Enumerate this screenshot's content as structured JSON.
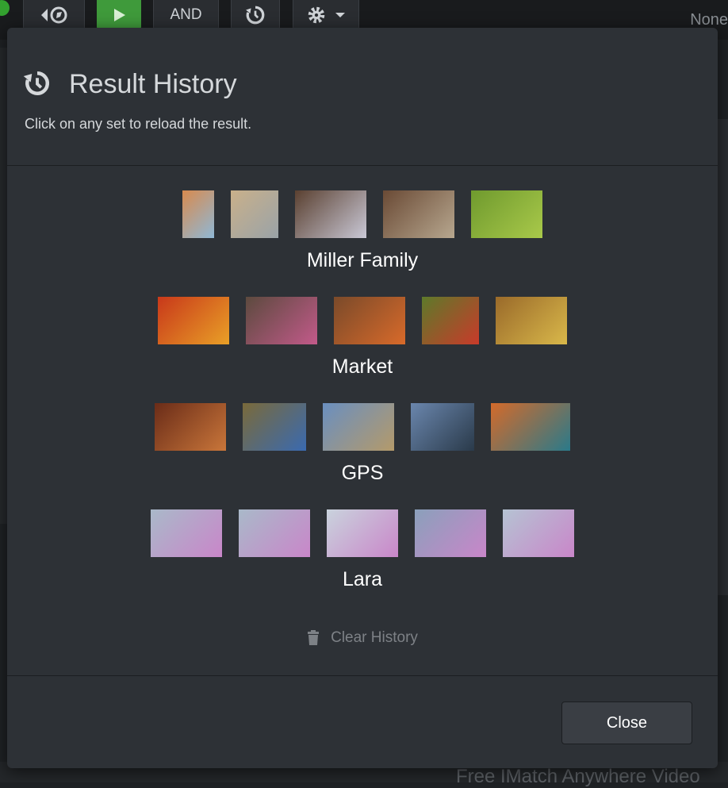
{
  "toolbar": {
    "and_label": "AND",
    "right_text": "None"
  },
  "background": {
    "bottom_text": "Free IMatch Anywhere Video"
  },
  "modal": {
    "title": "Result History",
    "subtitle": "Click on any set to reload the result.",
    "sets": [
      {
        "label": "Miller Family",
        "thumbs": [
          {
            "w": 40,
            "c1": "#d88a4e",
            "c2": "#8fb8d6"
          },
          {
            "w": 60,
            "c1": "#c9b08a",
            "c2": "#9aa3a8"
          },
          {
            "w": 90,
            "c1": "#5a4030",
            "c2": "#c9c8d6"
          },
          {
            "w": 90,
            "c1": "#6a4a35",
            "c2": "#b7a78f"
          },
          {
            "w": 90,
            "c1": "#6f9a2e",
            "c2": "#a9c94a"
          }
        ]
      },
      {
        "label": "Market",
        "thumbs": [
          {
            "w": 90,
            "c1": "#c8381a",
            "c2": "#e9a027"
          },
          {
            "w": 90,
            "c1": "#5c4a3e",
            "c2": "#c25a8a"
          },
          {
            "w": 90,
            "c1": "#7a4a2a",
            "c2": "#d86a2a"
          },
          {
            "w": 72,
            "c1": "#5d7a2a",
            "c2": "#c93a2a"
          },
          {
            "w": 90,
            "c1": "#9a6a2a",
            "c2": "#d9b84a"
          }
        ]
      },
      {
        "label": "GPS",
        "thumbs": [
          {
            "w": 90,
            "c1": "#6a2c18",
            "c2": "#c9763a"
          },
          {
            "w": 80,
            "c1": "#7a6a3a",
            "c2": "#3a6ab0"
          },
          {
            "w": 90,
            "c1": "#6a8fc0",
            "c2": "#b49a6a"
          },
          {
            "w": 80,
            "c1": "#6a86ad",
            "c2": "#2a3a4a"
          },
          {
            "w": 100,
            "c1": "#d46a2a",
            "c2": "#2a7a8a"
          }
        ]
      },
      {
        "label": "Lara",
        "thumbs": [
          {
            "w": 90,
            "c1": "#a9b9c9",
            "c2": "#c986c9"
          },
          {
            "w": 90,
            "c1": "#a9b9c9",
            "c2": "#c986c9"
          },
          {
            "w": 90,
            "c1": "#c9d3dd",
            "c2": "#c986c9"
          },
          {
            "w": 90,
            "c1": "#8aa0bb",
            "c2": "#c986c9"
          },
          {
            "w": 90,
            "c1": "#b5c3d3",
            "c2": "#c986c9"
          }
        ]
      }
    ],
    "clear_label": "Clear History",
    "close_label": "Close"
  }
}
